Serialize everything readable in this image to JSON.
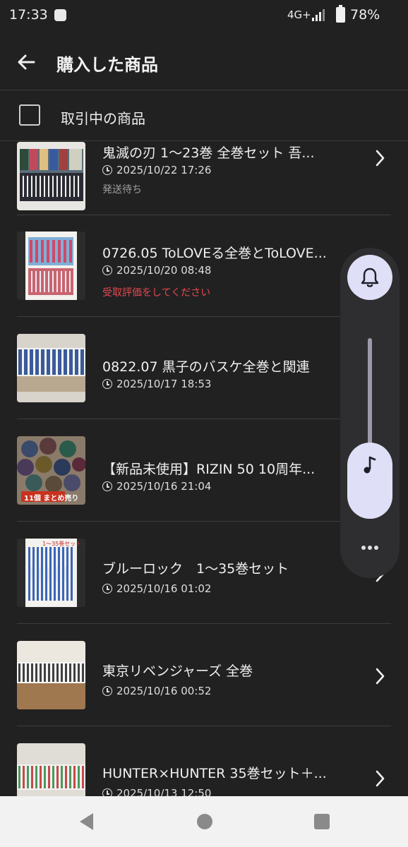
{
  "status_bar": {
    "time": "17:33",
    "network": "4G+",
    "battery": "78%"
  },
  "header": {
    "title": "購入した商品",
    "back_icon": "arrow-left-icon"
  },
  "filter": {
    "label": "取引中の商品",
    "checked": false
  },
  "items": [
    {
      "title": "鬼滅の刃 1〜23巻 全巻セット 吾...",
      "date": "2025/10/22 17:26",
      "status": "発送待ち",
      "status_color": "#9e9e9e"
    },
    {
      "title": "0726.05 ToLOVEる全巻とToLOVE...",
      "date": "2025/10/20 08:48",
      "status": "受取評価をしてください",
      "status_color": "#e8474f"
    },
    {
      "title": "0822.07 黒子のバスケ全巻と関連",
      "date": "2025/10/17 18:53",
      "status": "",
      "status_color": ""
    },
    {
      "title": "【新品未使用】RIZIN 50 10周年...",
      "date": "2025/10/16 21:04",
      "status": "",
      "status_color": "",
      "thumb_badge": "11個 まとめ売り"
    },
    {
      "title": "ブルーロック　1〜35巻セット",
      "date": "2025/10/16 01:02",
      "status": "",
      "status_color": "",
      "thumb_caption": "1〜35巻セット"
    },
    {
      "title": "東京リベンジャーズ 全巻",
      "date": "2025/10/16 00:52",
      "status": "",
      "status_color": ""
    },
    {
      "title": "HUNTER×HUNTER 35巻セット＋...",
      "date": "2025/10/13 12:50",
      "status": "",
      "status_color": ""
    }
  ],
  "volume_panel": {
    "ring_icon": "bell-icon",
    "media_icon": "music-note-icon",
    "more_icon": "more-horizontal-icon",
    "media_level": 0.15
  },
  "colors": {
    "background": "#212121",
    "accent_red": "#e8474f",
    "panel": "#2e2e30",
    "panel_accent": "#dfe0f7"
  }
}
